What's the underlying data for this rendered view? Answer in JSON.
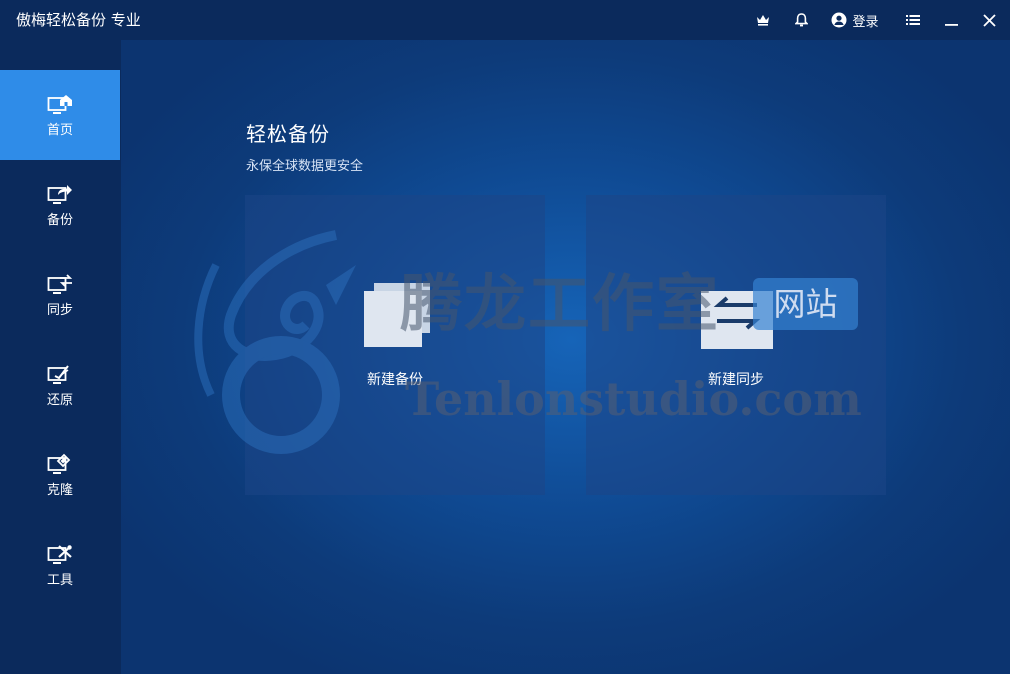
{
  "titlebar": {
    "title": "傲梅轻松备份 专业",
    "login_label": "登录"
  },
  "sidebar": {
    "items": [
      {
        "label": "首页",
        "icon": "home-monitor-icon",
        "active": true
      },
      {
        "label": "备份",
        "icon": "backup-monitor-icon",
        "active": false
      },
      {
        "label": "同步",
        "icon": "sync-monitor-icon",
        "active": false
      },
      {
        "label": "还原",
        "icon": "restore-monitor-icon",
        "active": false
      },
      {
        "label": "克隆",
        "icon": "clone-monitor-icon",
        "active": false
      },
      {
        "label": "工具",
        "icon": "tools-monitor-icon",
        "active": false
      }
    ]
  },
  "main": {
    "title": "轻松备份",
    "subtitle": "永保全球数据更安全",
    "cards": [
      {
        "label": "新建备份",
        "icon": "new-backup-icon"
      },
      {
        "label": "新建同步",
        "icon": "new-sync-icon"
      }
    ]
  },
  "watermark": {
    "cn_text": "腾龙工作室",
    "badge_text": "网站",
    "en_text": "Tenlonstudio.com"
  },
  "colors": {
    "sidebar_bg": "#0b2a5c",
    "active_nav": "#2f8ce8",
    "main_bg": "#0f4a93"
  }
}
